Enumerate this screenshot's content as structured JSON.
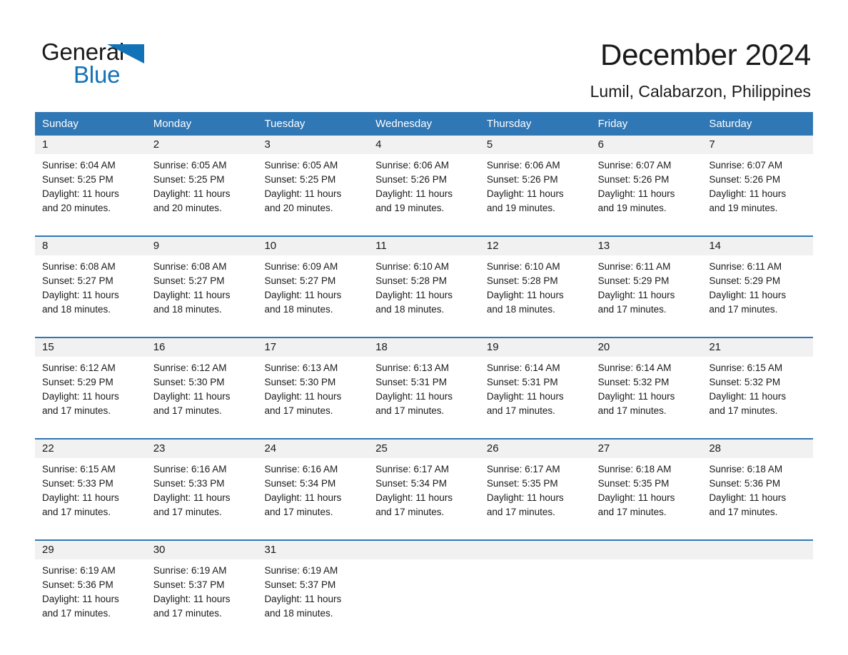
{
  "logo": {
    "word_one": "General",
    "word_two": "Blue",
    "triangle_color": "#1272b8",
    "text_color": "#1a1a1a"
  },
  "header": {
    "month_title": "December 2024",
    "location": "Lumil, Calabarzon, Philippines"
  },
  "theme": {
    "header_blue": "#3077b5",
    "date_band_gray": "#f1f1f1",
    "text": "#1a1a1a",
    "page_background": "#ffffff"
  },
  "weekdays": [
    "Sunday",
    "Monday",
    "Tuesday",
    "Wednesday",
    "Thursday",
    "Friday",
    "Saturday"
  ],
  "labels": {
    "sunrise_prefix": "Sunrise:",
    "sunset_prefix": "Sunset:",
    "daylight_prefix": "Daylight:"
  },
  "weeks": [
    [
      {
        "day": "1",
        "sunrise": "Sunrise: 6:04 AM",
        "sunset": "Sunset: 5:25 PM",
        "daylight_line1": "Daylight: 11 hours",
        "daylight_line2": "and 20 minutes."
      },
      {
        "day": "2",
        "sunrise": "Sunrise: 6:05 AM",
        "sunset": "Sunset: 5:25 PM",
        "daylight_line1": "Daylight: 11 hours",
        "daylight_line2": "and 20 minutes."
      },
      {
        "day": "3",
        "sunrise": "Sunrise: 6:05 AM",
        "sunset": "Sunset: 5:25 PM",
        "daylight_line1": "Daylight: 11 hours",
        "daylight_line2": "and 20 minutes."
      },
      {
        "day": "4",
        "sunrise": "Sunrise: 6:06 AM",
        "sunset": "Sunset: 5:26 PM",
        "daylight_line1": "Daylight: 11 hours",
        "daylight_line2": "and 19 minutes."
      },
      {
        "day": "5",
        "sunrise": "Sunrise: 6:06 AM",
        "sunset": "Sunset: 5:26 PM",
        "daylight_line1": "Daylight: 11 hours",
        "daylight_line2": "and 19 minutes."
      },
      {
        "day": "6",
        "sunrise": "Sunrise: 6:07 AM",
        "sunset": "Sunset: 5:26 PM",
        "daylight_line1": "Daylight: 11 hours",
        "daylight_line2": "and 19 minutes."
      },
      {
        "day": "7",
        "sunrise": "Sunrise: 6:07 AM",
        "sunset": "Sunset: 5:26 PM",
        "daylight_line1": "Daylight: 11 hours",
        "daylight_line2": "and 19 minutes."
      }
    ],
    [
      {
        "day": "8",
        "sunrise": "Sunrise: 6:08 AM",
        "sunset": "Sunset: 5:27 PM",
        "daylight_line1": "Daylight: 11 hours",
        "daylight_line2": "and 18 minutes."
      },
      {
        "day": "9",
        "sunrise": "Sunrise: 6:08 AM",
        "sunset": "Sunset: 5:27 PM",
        "daylight_line1": "Daylight: 11 hours",
        "daylight_line2": "and 18 minutes."
      },
      {
        "day": "10",
        "sunrise": "Sunrise: 6:09 AM",
        "sunset": "Sunset: 5:27 PM",
        "daylight_line1": "Daylight: 11 hours",
        "daylight_line2": "and 18 minutes."
      },
      {
        "day": "11",
        "sunrise": "Sunrise: 6:10 AM",
        "sunset": "Sunset: 5:28 PM",
        "daylight_line1": "Daylight: 11 hours",
        "daylight_line2": "and 18 minutes."
      },
      {
        "day": "12",
        "sunrise": "Sunrise: 6:10 AM",
        "sunset": "Sunset: 5:28 PM",
        "daylight_line1": "Daylight: 11 hours",
        "daylight_line2": "and 18 minutes."
      },
      {
        "day": "13",
        "sunrise": "Sunrise: 6:11 AM",
        "sunset": "Sunset: 5:29 PM",
        "daylight_line1": "Daylight: 11 hours",
        "daylight_line2": "and 17 minutes."
      },
      {
        "day": "14",
        "sunrise": "Sunrise: 6:11 AM",
        "sunset": "Sunset: 5:29 PM",
        "daylight_line1": "Daylight: 11 hours",
        "daylight_line2": "and 17 minutes."
      }
    ],
    [
      {
        "day": "15",
        "sunrise": "Sunrise: 6:12 AM",
        "sunset": "Sunset: 5:29 PM",
        "daylight_line1": "Daylight: 11 hours",
        "daylight_line2": "and 17 minutes."
      },
      {
        "day": "16",
        "sunrise": "Sunrise: 6:12 AM",
        "sunset": "Sunset: 5:30 PM",
        "daylight_line1": "Daylight: 11 hours",
        "daylight_line2": "and 17 minutes."
      },
      {
        "day": "17",
        "sunrise": "Sunrise: 6:13 AM",
        "sunset": "Sunset: 5:30 PM",
        "daylight_line1": "Daylight: 11 hours",
        "daylight_line2": "and 17 minutes."
      },
      {
        "day": "18",
        "sunrise": "Sunrise: 6:13 AM",
        "sunset": "Sunset: 5:31 PM",
        "daylight_line1": "Daylight: 11 hours",
        "daylight_line2": "and 17 minutes."
      },
      {
        "day": "19",
        "sunrise": "Sunrise: 6:14 AM",
        "sunset": "Sunset: 5:31 PM",
        "daylight_line1": "Daylight: 11 hours",
        "daylight_line2": "and 17 minutes."
      },
      {
        "day": "20",
        "sunrise": "Sunrise: 6:14 AM",
        "sunset": "Sunset: 5:32 PM",
        "daylight_line1": "Daylight: 11 hours",
        "daylight_line2": "and 17 minutes."
      },
      {
        "day": "21",
        "sunrise": "Sunrise: 6:15 AM",
        "sunset": "Sunset: 5:32 PM",
        "daylight_line1": "Daylight: 11 hours",
        "daylight_line2": "and 17 minutes."
      }
    ],
    [
      {
        "day": "22",
        "sunrise": "Sunrise: 6:15 AM",
        "sunset": "Sunset: 5:33 PM",
        "daylight_line1": "Daylight: 11 hours",
        "daylight_line2": "and 17 minutes."
      },
      {
        "day": "23",
        "sunrise": "Sunrise: 6:16 AM",
        "sunset": "Sunset: 5:33 PM",
        "daylight_line1": "Daylight: 11 hours",
        "daylight_line2": "and 17 minutes."
      },
      {
        "day": "24",
        "sunrise": "Sunrise: 6:16 AM",
        "sunset": "Sunset: 5:34 PM",
        "daylight_line1": "Daylight: 11 hours",
        "daylight_line2": "and 17 minutes."
      },
      {
        "day": "25",
        "sunrise": "Sunrise: 6:17 AM",
        "sunset": "Sunset: 5:34 PM",
        "daylight_line1": "Daylight: 11 hours",
        "daylight_line2": "and 17 minutes."
      },
      {
        "day": "26",
        "sunrise": "Sunrise: 6:17 AM",
        "sunset": "Sunset: 5:35 PM",
        "daylight_line1": "Daylight: 11 hours",
        "daylight_line2": "and 17 minutes."
      },
      {
        "day": "27",
        "sunrise": "Sunrise: 6:18 AM",
        "sunset": "Sunset: 5:35 PM",
        "daylight_line1": "Daylight: 11 hours",
        "daylight_line2": "and 17 minutes."
      },
      {
        "day": "28",
        "sunrise": "Sunrise: 6:18 AM",
        "sunset": "Sunset: 5:36 PM",
        "daylight_line1": "Daylight: 11 hours",
        "daylight_line2": "and 17 minutes."
      }
    ],
    [
      {
        "day": "29",
        "sunrise": "Sunrise: 6:19 AM",
        "sunset": "Sunset: 5:36 PM",
        "daylight_line1": "Daylight: 11 hours",
        "daylight_line2": "and 17 minutes."
      },
      {
        "day": "30",
        "sunrise": "Sunrise: 6:19 AM",
        "sunset": "Sunset: 5:37 PM",
        "daylight_line1": "Daylight: 11 hours",
        "daylight_line2": "and 17 minutes."
      },
      {
        "day": "31",
        "sunrise": "Sunrise: 6:19 AM",
        "sunset": "Sunset: 5:37 PM",
        "daylight_line1": "Daylight: 11 hours",
        "daylight_line2": "and 18 minutes."
      },
      null,
      null,
      null,
      null
    ]
  ]
}
